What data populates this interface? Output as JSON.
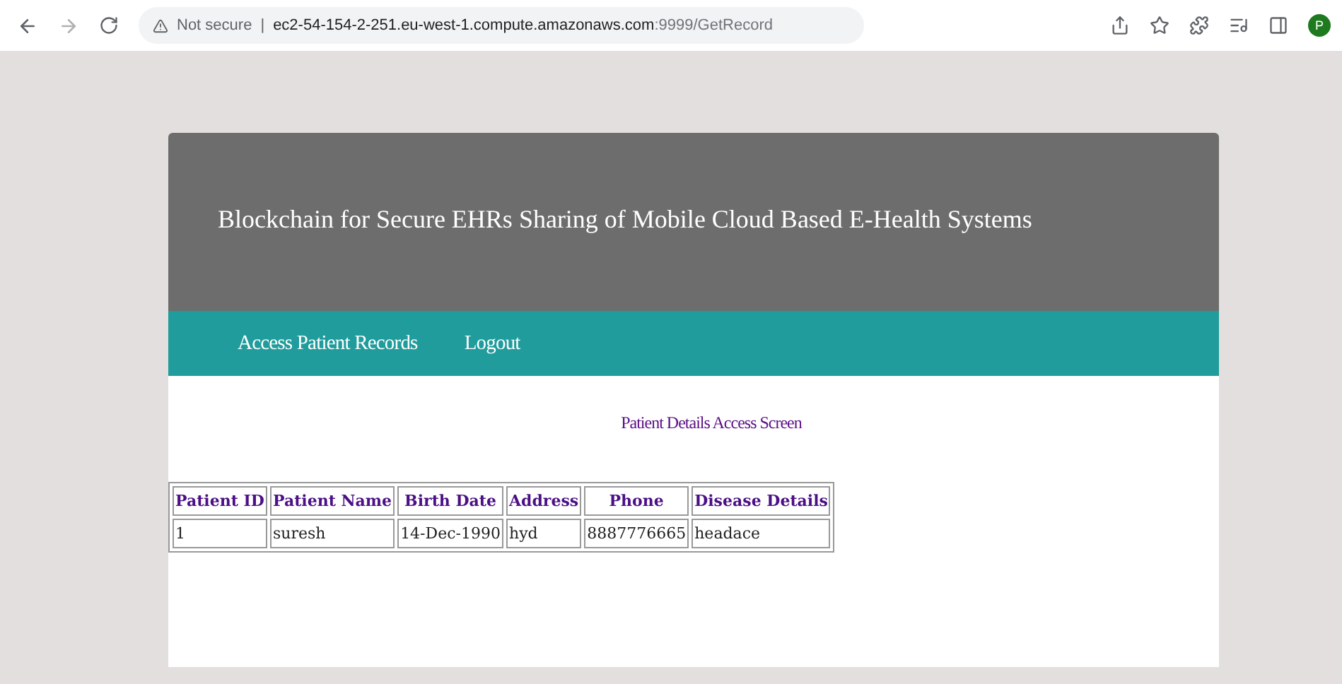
{
  "browser": {
    "security": "Not secure",
    "separator": "|",
    "url_host": "ec2-54-154-2-251.eu-west-1.compute.amazonaws.com",
    "url_path": ":9999/GetRecord",
    "avatar": "P"
  },
  "header": {
    "title": "Blockchain for Secure EHRs Sharing of Mobile Cloud Based E-Health Systems"
  },
  "nav": [
    "Access Patient Records",
    "Logout"
  ],
  "content": {
    "heading": "Patient Details Access Screen"
  },
  "table": {
    "columns": [
      "Patient ID",
      "Patient Name",
      "Birth Date",
      "Address",
      "Phone",
      "Disease Details"
    ],
    "rows": [
      [
        "1",
        "suresh",
        "14-Dec-1990",
        "hyd",
        "8887776665",
        "headace"
      ]
    ]
  }
}
